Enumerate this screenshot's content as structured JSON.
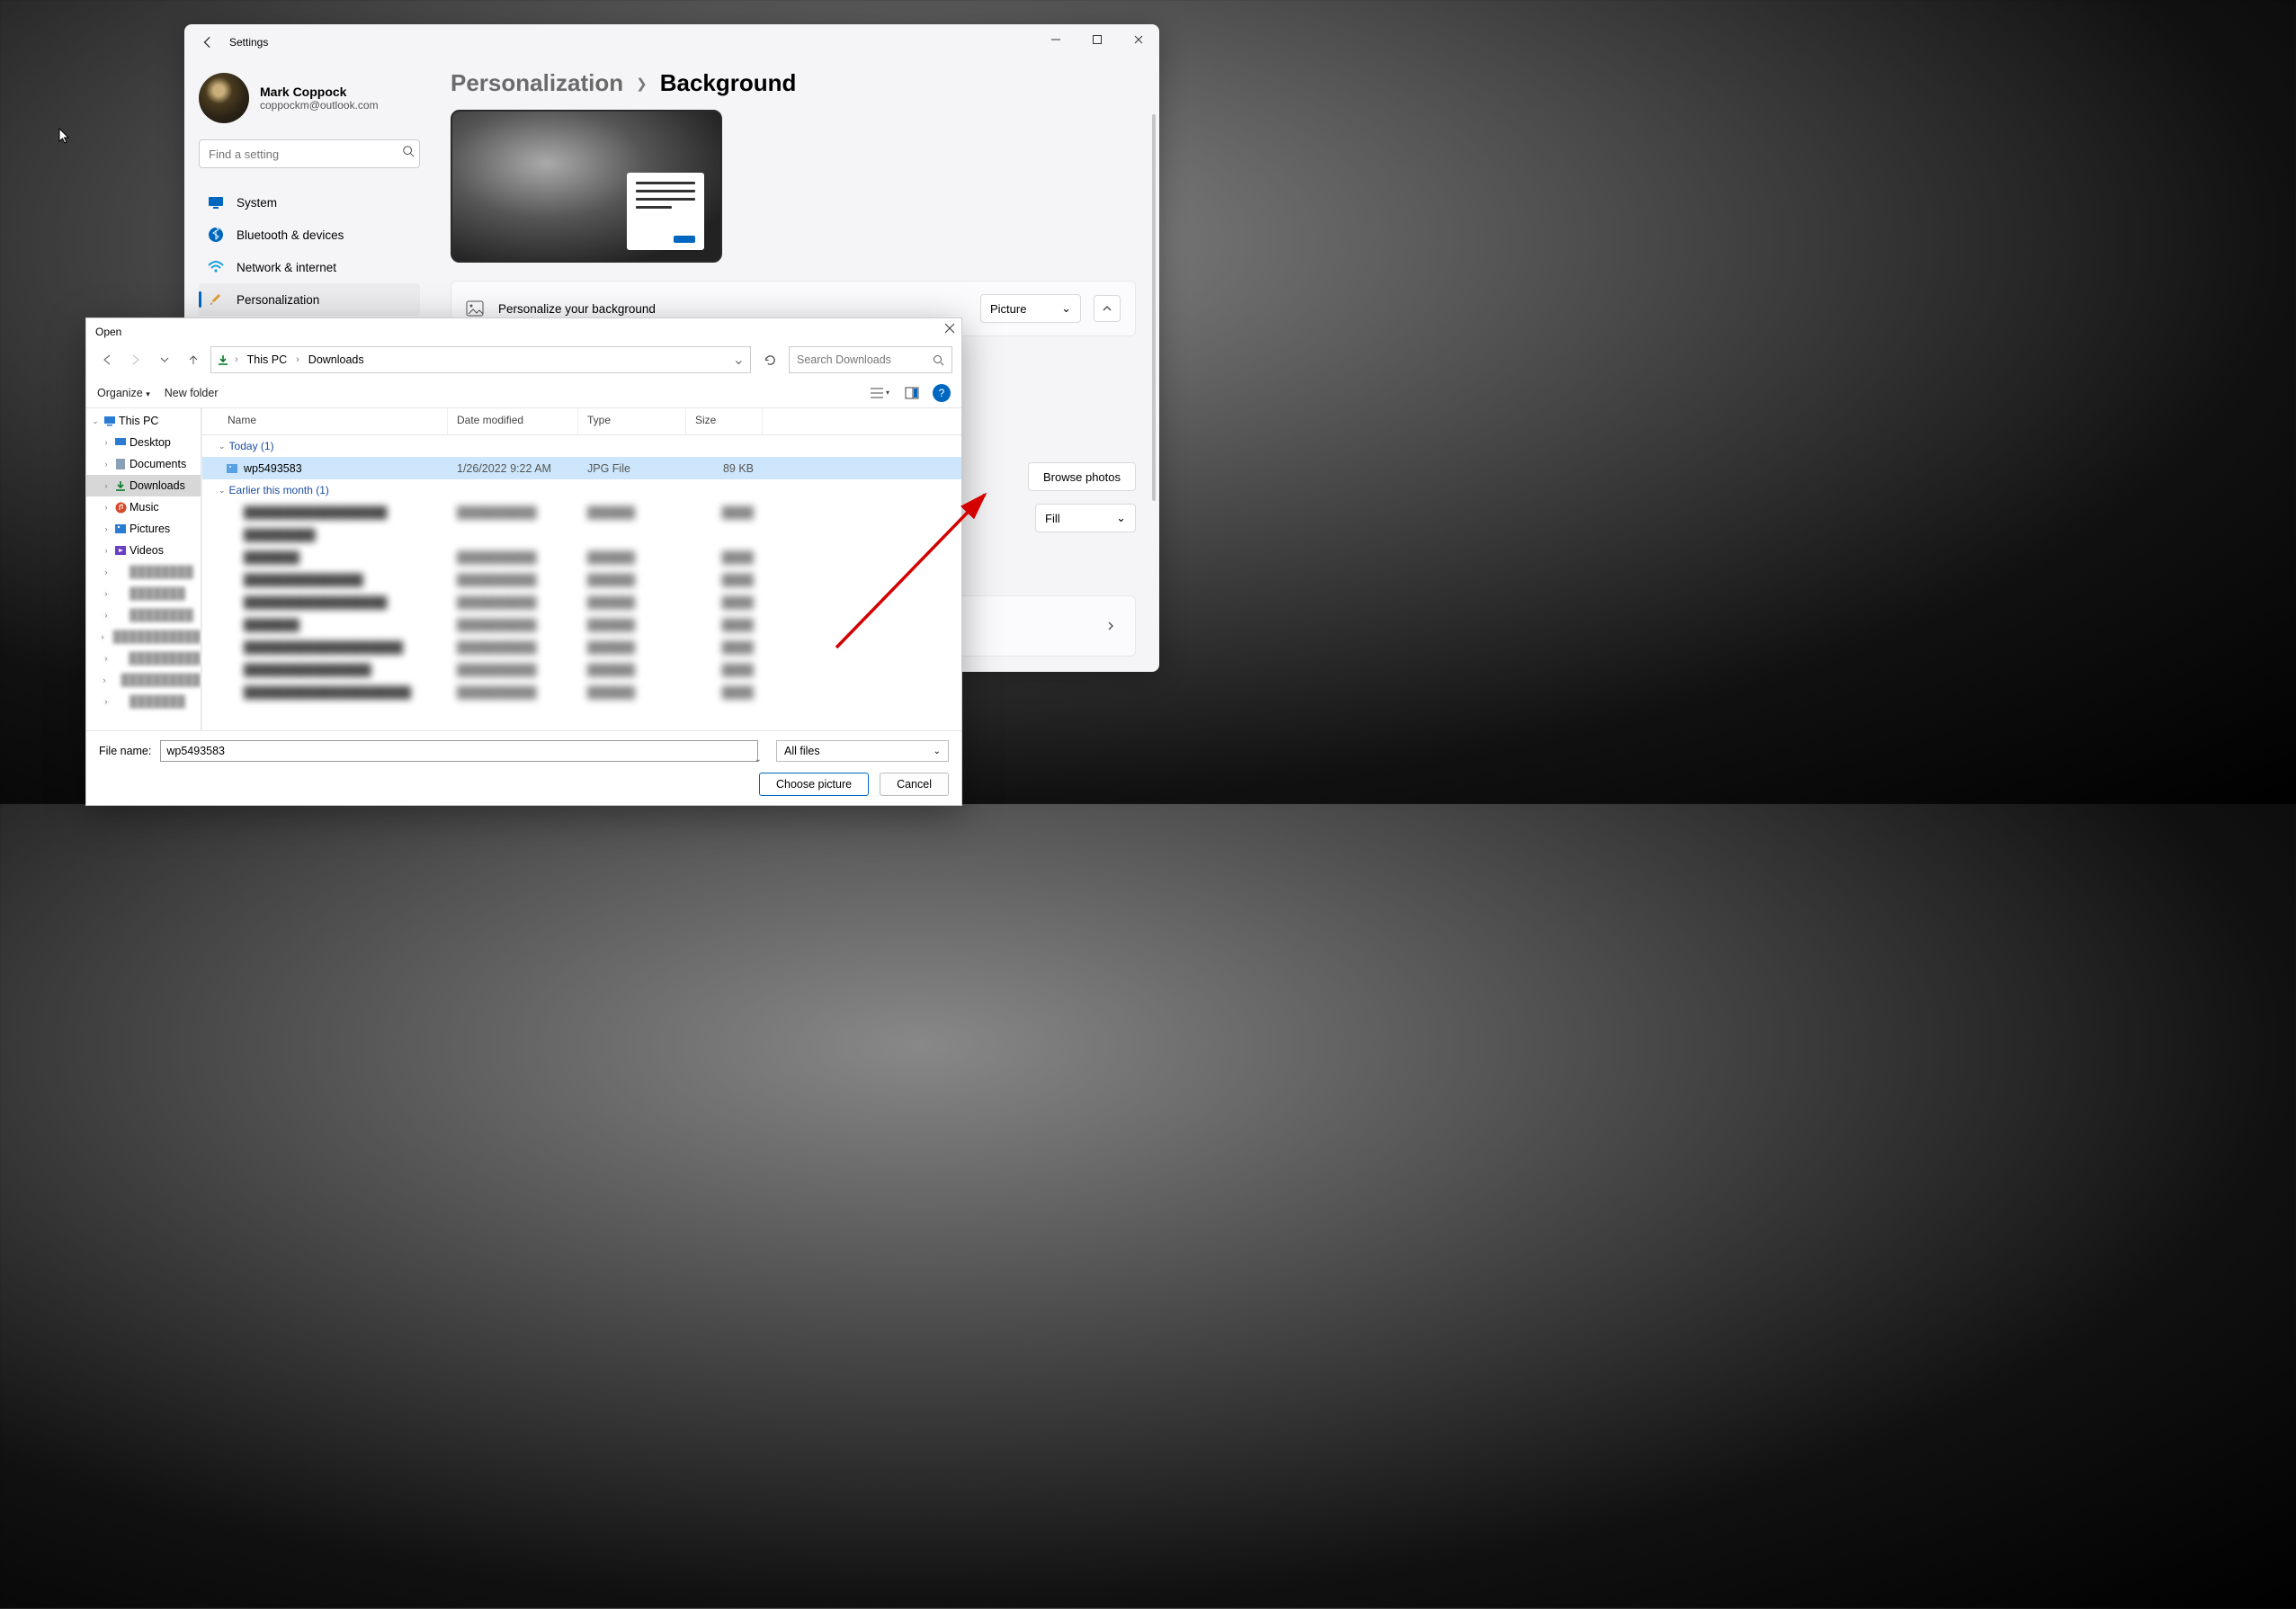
{
  "settings": {
    "app_title": "Settings",
    "user": {
      "name": "Mark Coppock",
      "email": "coppockm@outlook.com"
    },
    "search_placeholder": "Find a setting",
    "nav": [
      {
        "label": "System"
      },
      {
        "label": "Bluetooth & devices"
      },
      {
        "label": "Network & internet"
      },
      {
        "label": "Personalization"
      }
    ],
    "breadcrumb": {
      "parent": "Personalization",
      "current": "Background"
    },
    "card": {
      "title": "Personalize your background",
      "dropdown": "Picture"
    },
    "browse_label": "Browse photos",
    "fit_dropdown": "Fill"
  },
  "dialog": {
    "title": "Open",
    "breadcrumb": [
      "This PC",
      "Downloads"
    ],
    "search_placeholder": "Search Downloads",
    "toolbar": {
      "organize": "Organize",
      "new_folder": "New folder"
    },
    "tree": {
      "root": "This PC",
      "children": [
        "Desktop",
        "Documents",
        "Downloads",
        "Music",
        "Pictures",
        "Videos"
      ]
    },
    "columns": [
      "Name",
      "Date modified",
      "Type",
      "Size"
    ],
    "groups": [
      {
        "header": "Today (1)",
        "rows": [
          {
            "name": "wp5493583",
            "date": "1/26/2022 9:22 AM",
            "type": "JPG File",
            "size": "89 KB",
            "selected": true
          }
        ]
      },
      {
        "header": "Earlier this month (1)",
        "rows": []
      }
    ],
    "filename_label": "File name:",
    "filename_value": "wp5493583",
    "filter": "All files",
    "choose_btn": "Choose picture",
    "cancel_btn": "Cancel"
  }
}
